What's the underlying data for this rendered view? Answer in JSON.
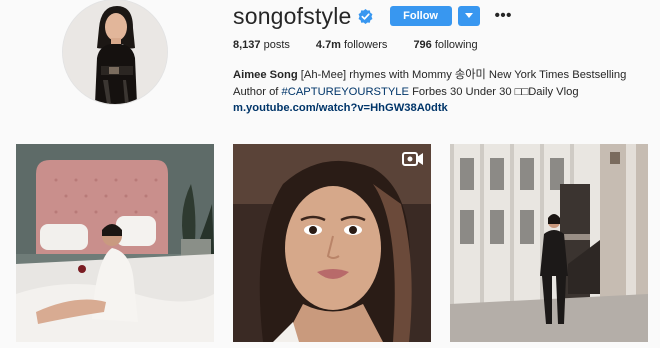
{
  "profile": {
    "username": "songofstyle",
    "follow_label": "Follow",
    "more_label": "•••",
    "stats": [
      {
        "value": "8,137",
        "label": "posts"
      },
      {
        "value": "4.7m",
        "label": "followers"
      },
      {
        "value": "796",
        "label": "following"
      }
    ],
    "bio": {
      "name": "Aimee Song",
      "line1_rest": " [Ah-Mee] rhymes with Mommy 송아미 New York Times Bestselling",
      "line2_prefix": "Author of ",
      "hashtag": "#CAPTUREYOURSTYLE",
      "line2_rest": " Forbes 30 Under 30 □□Daily Vlog",
      "link": "m.youtube.com/watch?v=HhGW38A0dtk"
    }
  },
  "posts": [
    {
      "kind": "photo"
    },
    {
      "kind": "video"
    },
    {
      "kind": "photo"
    }
  ],
  "colors": {
    "accent": "#3897f0",
    "link": "#003569",
    "verified": "#3897f0",
    "background": "#fafafa"
  }
}
